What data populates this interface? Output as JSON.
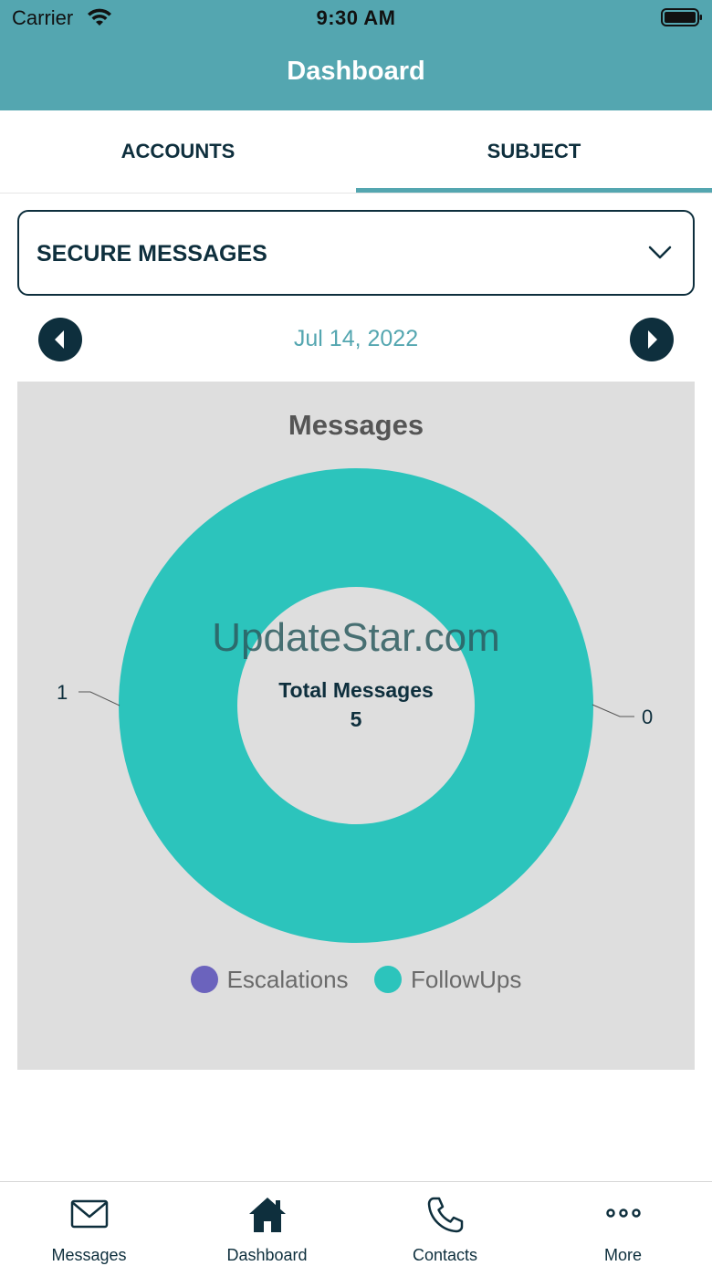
{
  "status_bar": {
    "carrier": "Carrier",
    "time": "9:30 AM"
  },
  "header": {
    "title": "Dashboard"
  },
  "tabs": [
    {
      "label": "ACCOUNTS",
      "selected": false
    },
    {
      "label": "SUBJECT",
      "selected": true
    }
  ],
  "dropdown": {
    "selected": "SECURE MESSAGES"
  },
  "date_nav": {
    "date": "Jul 14, 2022"
  },
  "chart_data": {
    "type": "pie",
    "title": "Messages",
    "subtype": "donut",
    "center_label": "Total Messages",
    "center_value": "5",
    "series": [
      {
        "name": "Escalations",
        "color": "#6b63bd",
        "value_label": "0"
      },
      {
        "name": "FollowUps",
        "color": "#2cc4bc",
        "value_label": "1"
      }
    ],
    "slice_fractions": [
      0,
      1
    ],
    "legend_position": "bottom"
  },
  "watermark": "UpdateStar.com",
  "bottom_nav": [
    {
      "label": "Messages",
      "icon": "envelope-icon"
    },
    {
      "label": "Dashboard",
      "icon": "home-icon"
    },
    {
      "label": "Contacts",
      "icon": "phone-icon"
    },
    {
      "label": "More",
      "icon": "more-dots-icon"
    }
  ],
  "colors": {
    "header": "#54a6b0",
    "dark": "#0e2f3d",
    "accent": "#54a6b0",
    "panel": "#dedede"
  }
}
